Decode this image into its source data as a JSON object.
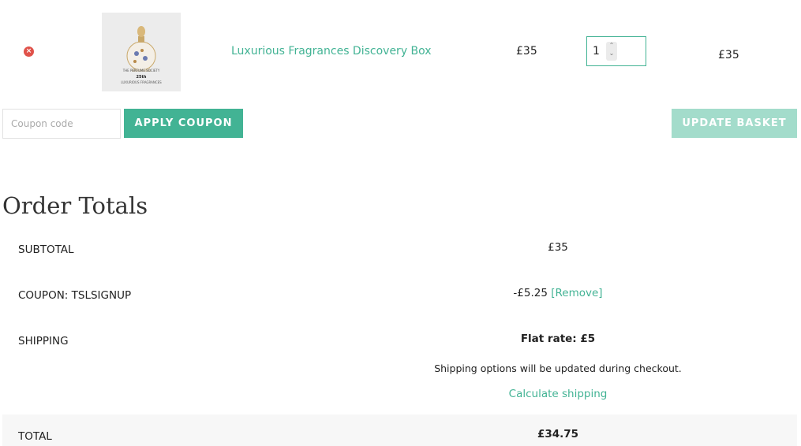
{
  "cart": {
    "remove_icon": "×",
    "product_name": "Luxurious Fragrances Discovery Box",
    "image": {
      "brand_line": "THE PERFUME SOCIETY",
      "bottom_line": "LUXURIOUS FRAGRANCES",
      "badge": "25th"
    },
    "unit_price": "£35",
    "quantity": "1",
    "line_total": "£35"
  },
  "coupon": {
    "placeholder": "Coupon code",
    "apply_label": "APPLY COUPON",
    "update_label": "UPDATE BASKET"
  },
  "totals": {
    "title": "Order Totals",
    "subtotal_label": "SUBTOTAL",
    "subtotal_value": "£35",
    "coupon_label": "COUPON: TSLSIGNUP",
    "coupon_value": "-£5.25",
    "coupon_remove": "[Remove]",
    "shipping_label": "SHIPPING",
    "shipping_rate": "Flat rate: £5",
    "shipping_note": "Shipping options will be updated during checkout.",
    "calculate_shipping": "Calculate shipping",
    "total_label": "TOTAL",
    "total_value": "£34.75"
  },
  "colors": {
    "accent": "#42b394",
    "accent_light": "#a3dccb",
    "remove": "#e0524a"
  }
}
